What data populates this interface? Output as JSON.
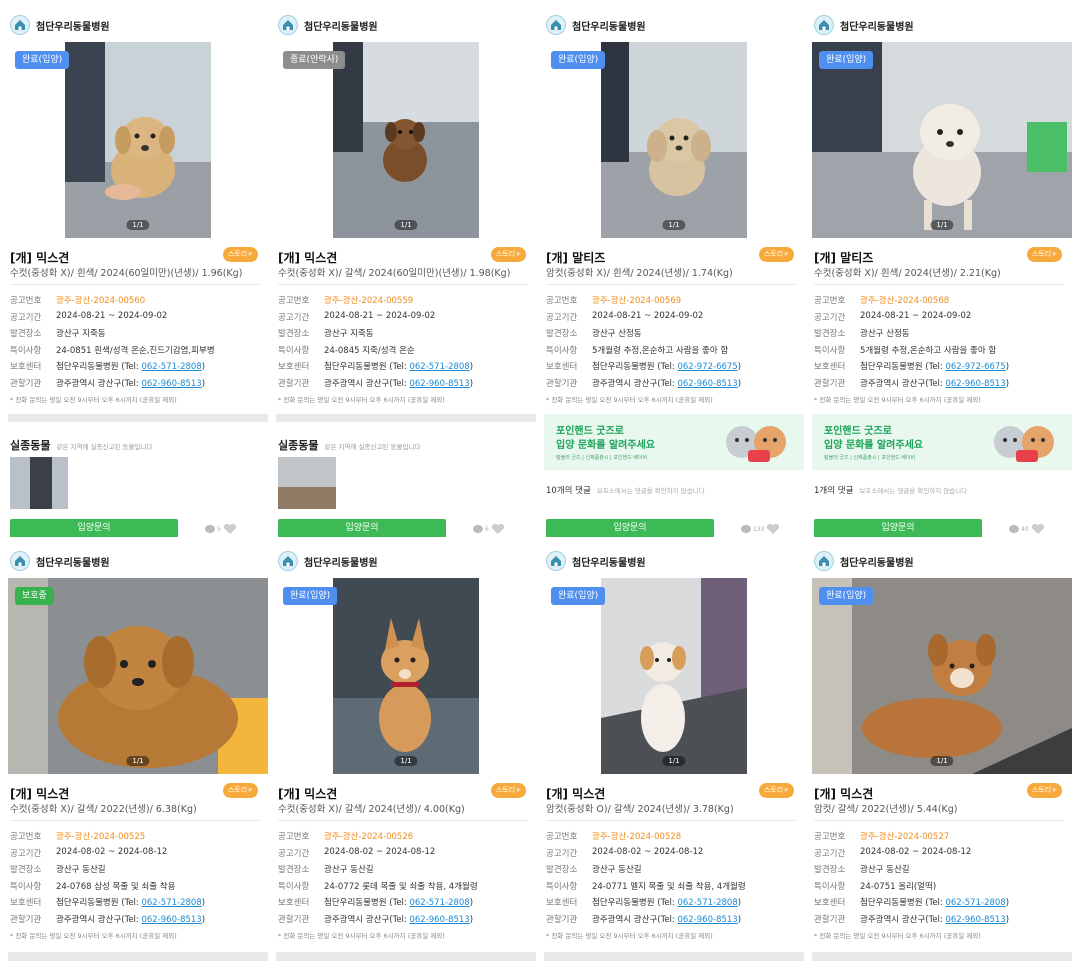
{
  "shelter_name": "첨단우리동물병원",
  "labels": {
    "notice_no": "공고번호",
    "notice_period": "공고기간",
    "found_place": "발견장소",
    "special": "특이사항",
    "center": "보호센터",
    "agency": "관할기관"
  },
  "story_tag": "스토리+",
  "page_indicator": "1/1",
  "note": "* 전화 문의는 평일 오전 9시부터 오후 6시까지 (공휴일 제외)",
  "colors": {
    "badge_done": "#4f8ff0",
    "badge_end": "#8d8d8d",
    "badge_protect": "#37b24d",
    "orange": "#f08c1c",
    "link": "#1b8bd6",
    "green": "#3dba56"
  },
  "cards": [
    {
      "status": "완료(입양)",
      "title": "[개] 믹스견",
      "subtitle": "수컷(중성화 X)/ 흰색/ 2024(60일미만)(년생)/ 1.96(Kg)",
      "notice_no": "광주-광산-2024-00560",
      "period": "2024-08-21 ~ 2024-09-02",
      "place": "광산구 지죽동",
      "special": "24-0851 흰색/성격 온순,진드기감염,피부병",
      "center_name": "첨단우리동물병원 (Tel: ",
      "center_tel": "062-571-2808",
      "agency_name": "광주광역시 광산구(Tel: ",
      "agency_tel": "062-960-8513",
      "image": "dog-puppy-tan"
    },
    {
      "status": "종료(안락사)",
      "title": "[개] 믹스견",
      "subtitle": "수컷(중성화 X)/ 갈색/ 2024(60일미만)(년생)/ 1.98(Kg)",
      "notice_no": "광주-광산-2024-00559",
      "period": "2024-08-21 ~ 2024-09-02",
      "place": "광산구 지죽동",
      "special": "24-0845 지죽/성격 온순",
      "center_name": "첨단우리동물병원 (Tel: ",
      "center_tel": "062-571-2808",
      "agency_name": "광주광역시 광산구(Tel: ",
      "agency_tel": "062-960-8513",
      "image": "dog-puppy-brown"
    },
    {
      "status": "완료(입양)",
      "title": "[개] 말티즈",
      "subtitle": "암컷(중성화 X)/ 흰색/ 2024(년생)/ 1.74(Kg)",
      "notice_no": "광주-광산-2024-00569",
      "period": "2024-08-21 ~ 2024-09-02",
      "place": "광산구 산정동",
      "special": "5개월령 추정,온순하고 사람을 좋아 함",
      "center_name": "첨단우리동물병원 (Tel: ",
      "center_tel": "062-972-6675",
      "agency_name": "광주광역시 광산구(Tel: ",
      "agency_tel": "062-960-8513",
      "image": "dog-maltese-cream"
    },
    {
      "status": "완료(입양)",
      "title": "[개] 말티즈",
      "subtitle": "수컷(중성화 X)/ 흰색/ 2024(년생)/ 2.21(Kg)",
      "notice_no": "광주-광산-2024-00568",
      "period": "2024-08-21 ~ 2024-09-02",
      "place": "광산구 산정동",
      "special": "5개월령 추정,온순하고 사람을 좋아 함",
      "center_name": "첨단우리동물병원 (Tel: ",
      "center_tel": "062-972-6675",
      "agency_name": "광주광역시 광산구(Tel: ",
      "agency_tel": "062-960-8513",
      "image": "dog-maltese-white"
    },
    {
      "status": "보호중",
      "title": "[개] 믹스견",
      "subtitle": "수컷(중성화 X)/ 갈색/ 2022(년생)/ 6.38(Kg)",
      "notice_no": "광주-광산-2024-00525",
      "period": "2024-08-02 ~ 2024-08-12",
      "place": "광산구 동산길",
      "special": "24-0768 삼성 목줄 및 쇠줄 착용",
      "center_name": "첨단우리동물병원 (Tel: ",
      "center_tel": "062-571-2808",
      "agency_name": "광주광역시 광산구(Tel: ",
      "agency_tel": "062-960-8513",
      "image": "dog-golden-fluffy"
    },
    {
      "status": "완료(입양)",
      "title": "[개] 믹스견",
      "subtitle": "수컷(중성화 X)/ 갈색/ 2024(년생)/ 4.00(Kg)",
      "notice_no": "광주-광산-2024-00526",
      "period": "2024-08-02 ~ 2024-08-12",
      "place": "광산구 동산길",
      "special": "24-0772 롯데 목줄 및 쇠줄 착용, 4개월령",
      "center_name": "첨단우리동물병원 (Tel: ",
      "center_tel": "062-571-2808",
      "agency_name": "광주광역시 광산구(Tel: ",
      "agency_tel": "062-960-8513",
      "image": "dog-jindo-tan"
    },
    {
      "status": "완료(입양)",
      "title": "[개] 믹스견",
      "subtitle": "암컷(중성화 O)/ 갈색/ 2024(년생)/ 3.78(Kg)",
      "notice_no": "광주-광산-2024-00528",
      "period": "2024-08-02 ~ 2024-08-12",
      "place": "광산구 동산길",
      "special": "24-0771 멜지 목줄 및 쇠줄 착용, 4개월령",
      "center_name": "첨단우리동물병원 (Tel: ",
      "center_tel": "062-571-2808",
      "agency_name": "광주광역시 광산구(Tel: ",
      "agency_tel": "062-960-8513",
      "image": "dog-white-sitting"
    },
    {
      "status": "완료(입양)",
      "title": "[개] 믹스견",
      "subtitle": "암컷/ 갈색/ 2022(년생)/ 5.44(Kg)",
      "notice_no": "광주-광산-2024-00527",
      "period": "2024-08-02 ~ 2024-08-12",
      "place": "광산구 동산길",
      "special": "24-0751 올리(얼떡)",
      "center_name": "첨단우리동물병원 (Tel: ",
      "center_tel": "062-571-2808",
      "agency_name": "광주광역시 광산구(Tel: ",
      "agency_tel": "062-960-8513",
      "image": "dog-brown-lying"
    }
  ],
  "missing": {
    "title": "실종동물",
    "desc": "같은 지역에 실종신고된 동물입니다"
  },
  "ad": {
    "line1": "포인핸드 굿즈로",
    "line2": "입양 문화를 알려주세요",
    "small": "텀블러 굿즈 | 신제품출시 | 포인핸드 베이비"
  },
  "comments": [
    {
      "count": "10개의 댓글",
      "desc": "보호소에서는 댓글을 확인하지 않습니다"
    },
    {
      "count": "1개의 댓글",
      "desc": "보호소에서는 댓글을 확인하지 않습니다"
    }
  ],
  "adopt_button": "입양문의",
  "reactions": [
    "5",
    "6",
    "133",
    "40"
  ]
}
